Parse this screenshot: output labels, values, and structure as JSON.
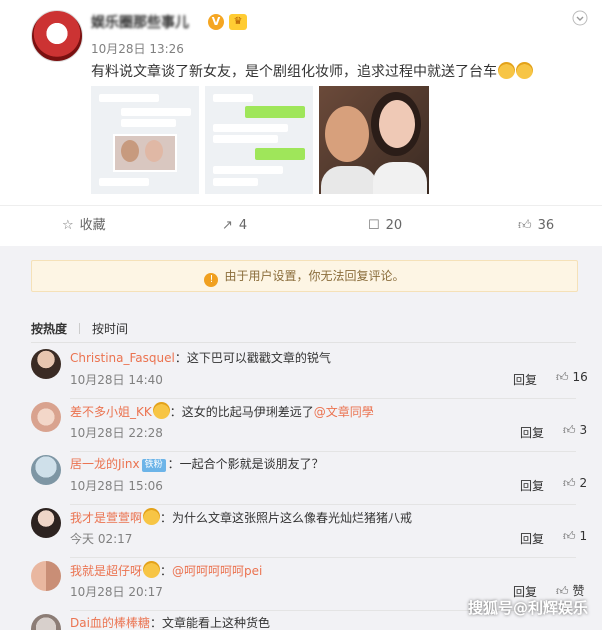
{
  "post": {
    "author": "娱乐圈那些事儿",
    "time": "10月28日 13:26",
    "text": "有料说文章谈了新女友，是个剧组化妆师，追求过程中就送了台车",
    "more_icon": "chevron-down-icon"
  },
  "actions": {
    "favorite_label": "收藏",
    "repost_count": "4",
    "comment_count": "20",
    "like_count": "36"
  },
  "notice": "由于用户设置，你无法回复评论。",
  "sort": {
    "hot": "按热度",
    "time": "按时间"
  },
  "comments": [
    {
      "user": "Christina_Fasquel",
      "text": "：这下巴可以戳戳文章的锐气",
      "time": "10月28日 14:40",
      "reply": "回复",
      "likes": "16"
    },
    {
      "user": "差不多小姐_KK",
      "text": "：这女的比起马伊琍差远了",
      "mention": "@文章同學",
      "time": "10月28日 22:28",
      "reply": "回复",
      "likes": "3"
    },
    {
      "user": "居一龙的Jinx",
      "badge": "铁粉",
      "text": "：一起合个影就是谈朋友了？",
      "time": "10月28日 15:06",
      "reply": "回复",
      "likes": "2"
    },
    {
      "user": "我才是萱萱啊",
      "text": "：为什么文章这张照片这么像春光灿烂猪猪八戒",
      "time": "今天 02:17",
      "reply": "回复",
      "likes": "1"
    },
    {
      "user": "我就是超仔呀",
      "text": "：",
      "mention": "@呵呵呵呵呵pei",
      "time": "10月28日 20:17",
      "reply": "回复",
      "likes": "赞"
    },
    {
      "user": "Dai血的棒棒糖",
      "text": "：文章能看上这种货色"
    }
  ],
  "watermark": "搜狐号@利辉娱乐",
  "colors": {
    "username": "#eb7350",
    "accent": "#ff8200",
    "badge_fan": "#6cb4e8"
  }
}
